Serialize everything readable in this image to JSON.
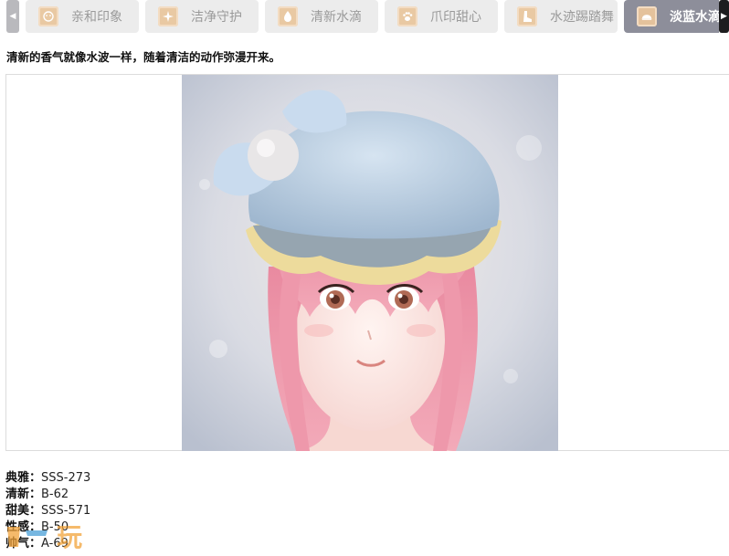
{
  "tabs": {
    "items": [
      {
        "label": "亲和印象",
        "icon": "face-icon",
        "active": false
      },
      {
        "label": "洁净守护",
        "icon": "sparkle-icon",
        "active": false
      },
      {
        "label": "清新水滴",
        "icon": "drop-icon",
        "active": false
      },
      {
        "label": "爪印甜心",
        "icon": "paw-icon",
        "active": false
      },
      {
        "label": "水迹踢踏舞",
        "icon": "shoe-icon",
        "active": false
      },
      {
        "label": "淡蓝水滴",
        "icon": "cap-icon",
        "active": true
      }
    ],
    "colors": {
      "inactive_bg": "#ececec",
      "active_bg": "#8d8e9a",
      "icon_bg": "#e9c9a3"
    }
  },
  "description": "清新的香气就像水波一样，随着清洁的动作弥漫开来。",
  "stats": [
    {
      "key": "典雅：",
      "value": "SSS-273"
    },
    {
      "key": "清新：",
      "value": "B-62"
    },
    {
      "key": "甜美：",
      "value": "SSS-571"
    },
    {
      "key": "性感：",
      "value": "B-50"
    },
    {
      "key": "帅气：",
      "value": "A-69"
    }
  ],
  "watermark": "玩"
}
